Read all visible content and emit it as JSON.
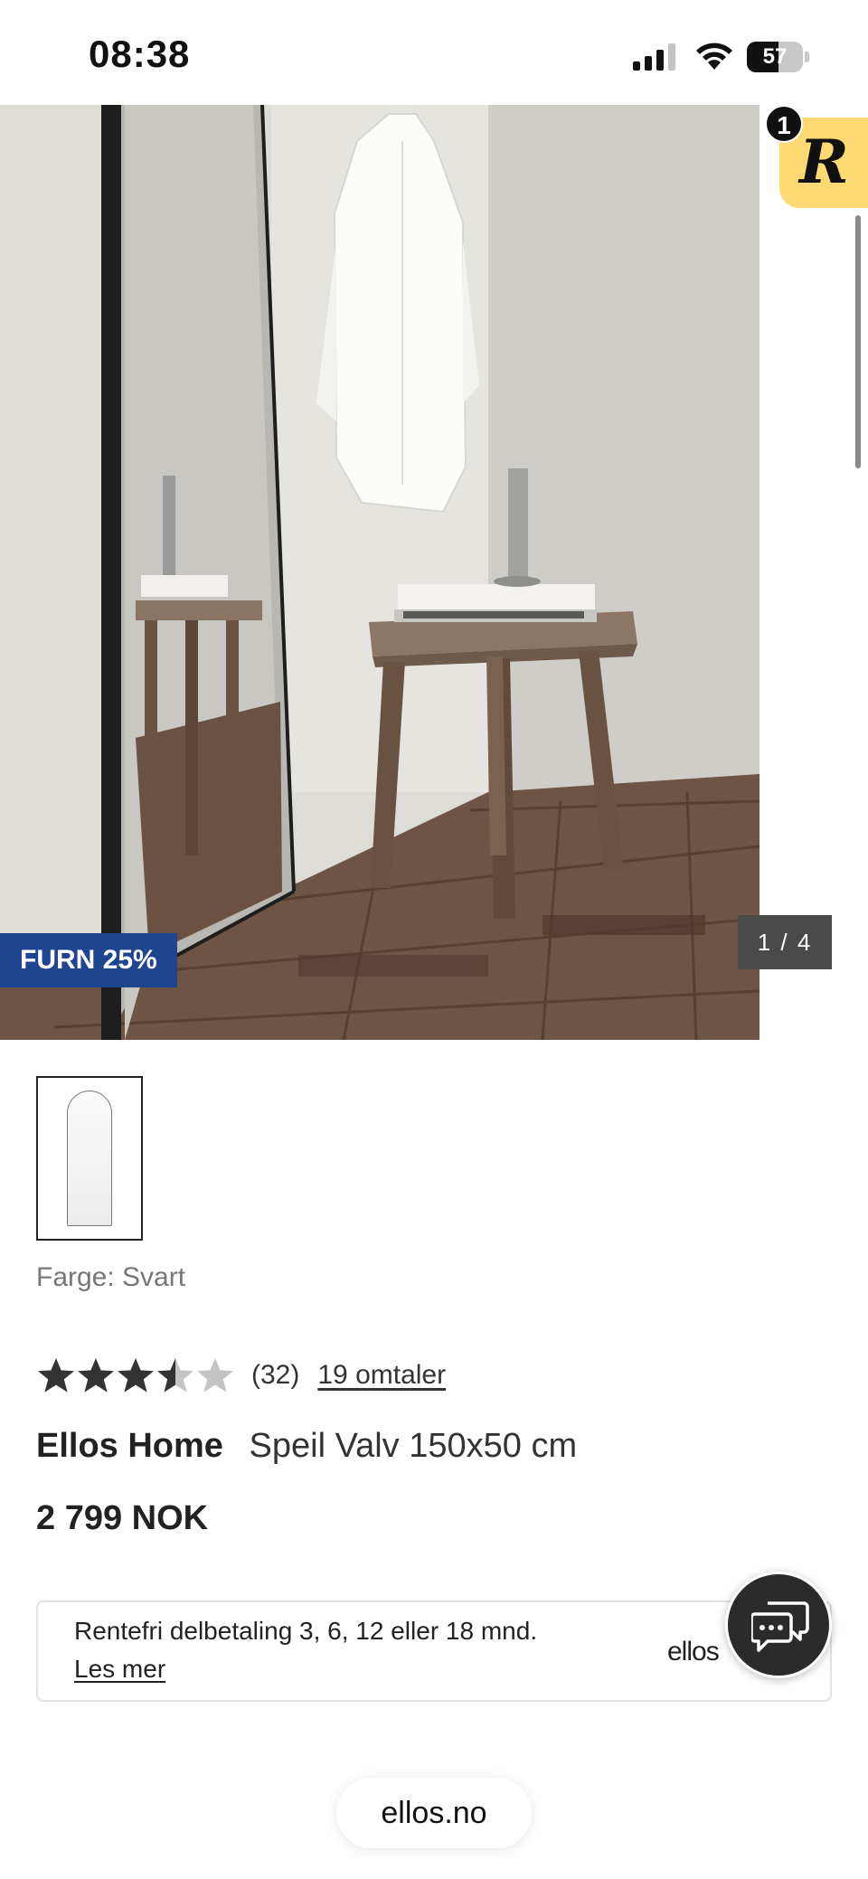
{
  "status_bar": {
    "time": "08:38",
    "battery_level": "57",
    "battery_fraction": 0.57,
    "signal_bars_active": 3,
    "signal_bars_total": 4
  },
  "gallery": {
    "promo_badge": "FURN 25%",
    "image_counter": "1 / 4",
    "image_description_icon": "product-photo"
  },
  "rewards_widget": {
    "letter": "R",
    "notification_count": "1",
    "accent_color": "#ffd972"
  },
  "product": {
    "color_label": "Farge: Svart",
    "rating": {
      "value": 3.5,
      "max": 5,
      "count": "(32)",
      "reviews_link": "19 omtaler"
    },
    "brand": "Ellos Home",
    "name": "Speil Valv 150x50 cm",
    "price": "2 799 NOK"
  },
  "financing": {
    "text": "Rentefri delbetaling 3, 6, 12 eller 18 mnd.",
    "link": "Les mer",
    "logo": "ellos"
  },
  "browser": {
    "url": "ellos.no"
  },
  "colors": {
    "promo_blue": "#1f4591",
    "chat_button": "#2b2b2b",
    "star_filled": "#333333",
    "star_empty": "#c4c4c4"
  }
}
